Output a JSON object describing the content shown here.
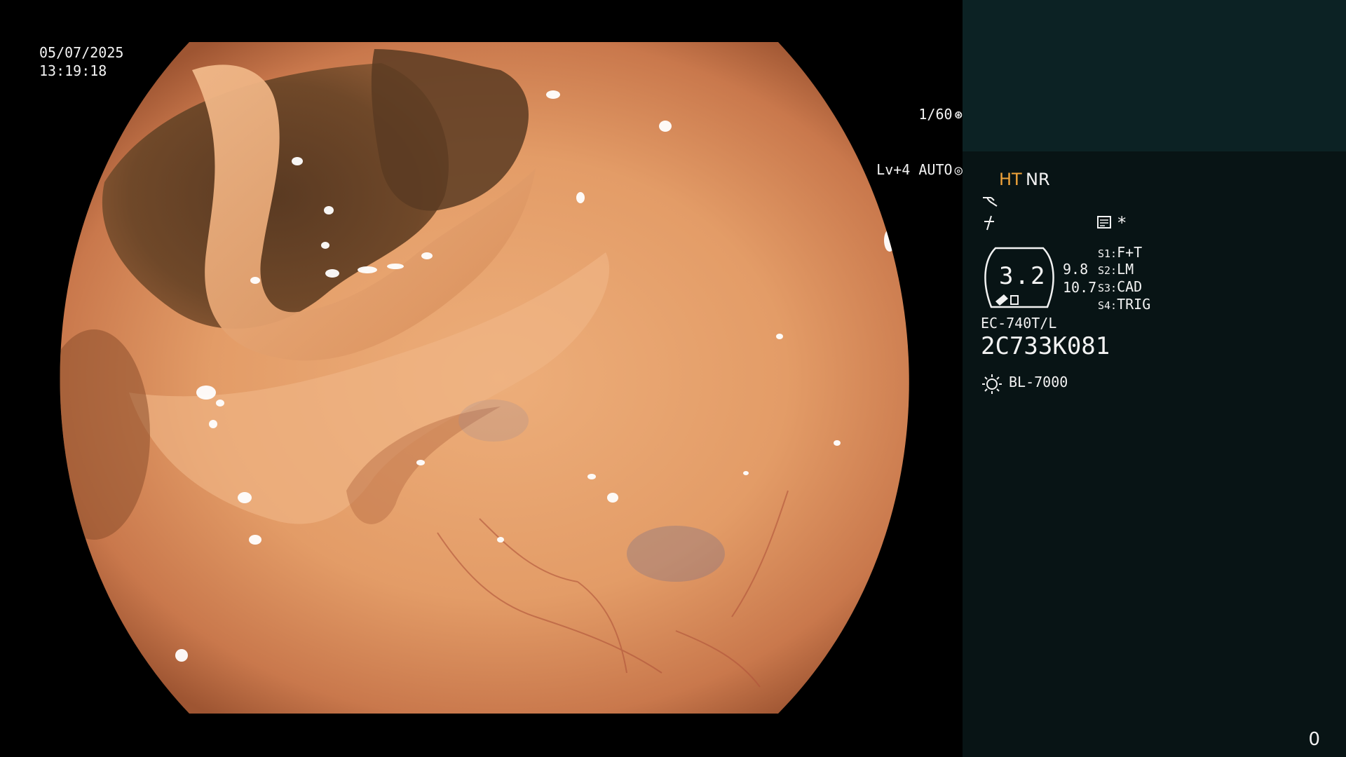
{
  "view": {
    "date": "05/07/2025",
    "time": "13:19:18",
    "shutter": "1/60",
    "shutter_icon": "aperture-icon",
    "brightness": "Lv+4 AUTO",
    "brightness_icon": "auto-iris-icon"
  },
  "panel": {
    "mode_ht": "HT",
    "mode_nr": "NR",
    "icons": [
      "tone-curve-icon",
      "flash-icon",
      "capture-icon"
    ],
    "star": "*",
    "zoom": {
      "value": "3.2",
      "min": "9.8",
      "max": "10.7"
    },
    "presets": [
      {
        "key": "S1:",
        "label": "F+T"
      },
      {
        "key": "S2:",
        "label": "LM"
      },
      {
        "key": "S3:",
        "label": "CAD"
      },
      {
        "key": "S4:",
        "label": "TRIG"
      }
    ],
    "scope_model": "EC-740T/L",
    "scope_serial": "2C733K081",
    "light_icon": "light-source-icon",
    "light_source": "BL-7000",
    "counter": "0"
  },
  "colors": {
    "accent": "#f0a33a",
    "panel_bg": "#081415",
    "panel_top_bg": "#0c2224",
    "tissue": "#e09a66"
  }
}
